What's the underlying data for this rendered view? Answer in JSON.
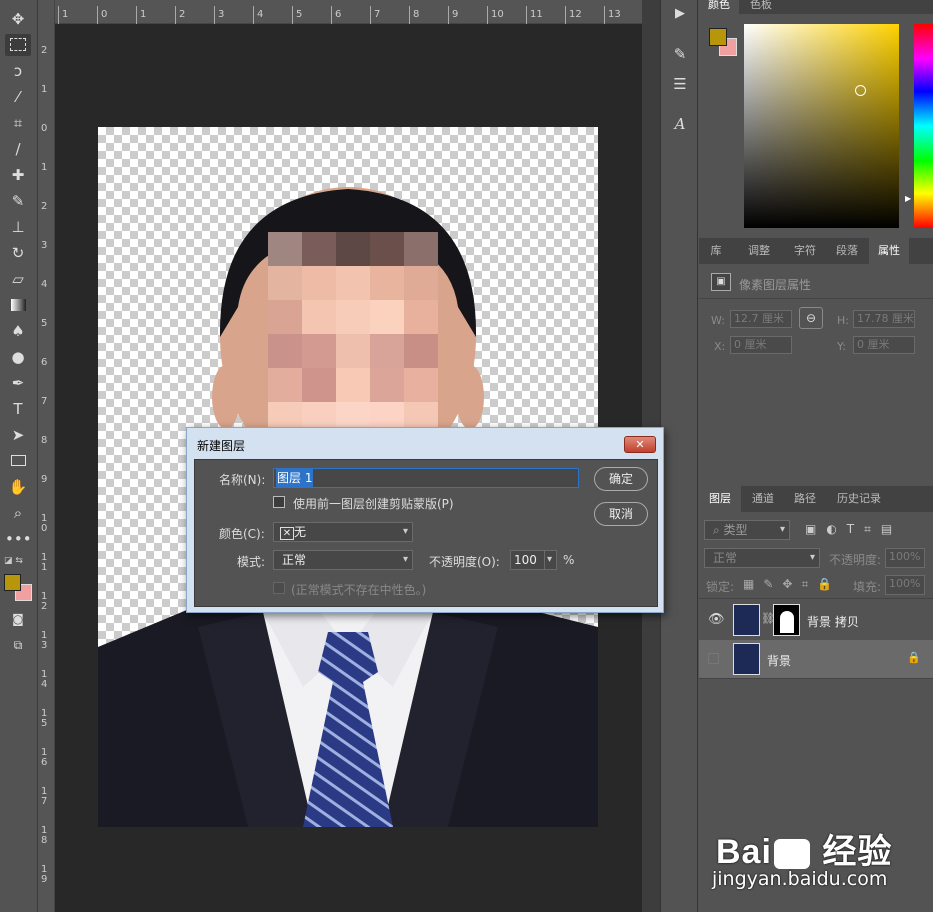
{
  "rulers": {
    "h_ticks": [
      "1",
      "0",
      "1",
      "2",
      "3",
      "4",
      "5",
      "6",
      "7",
      "8",
      "9",
      "10",
      "11",
      "12",
      "13"
    ],
    "v_ticks": [
      "2",
      "1",
      "0",
      "1",
      "2",
      "3",
      "4",
      "5",
      "6",
      "7",
      "8",
      "9",
      "1\n0",
      "1\n1",
      "1\n2",
      "1\n3",
      "1\n4",
      "1\n5",
      "1\n6",
      "1\n7",
      "1\n8",
      "1\n9"
    ]
  },
  "colors": {
    "foreground": "#b8960c",
    "background": "#f0a0a0",
    "accent": "#2d73c8"
  },
  "color_panel": {
    "tabs": [
      "颜色",
      "色板"
    ]
  },
  "properties_panel": {
    "tabs": [
      "库",
      "调整",
      "字符",
      "段落",
      "属性"
    ],
    "title": "像素图层属性",
    "w_label": "W:",
    "w_value": "12.7 厘米",
    "h_label": "H:",
    "h_value": "17.78 厘米",
    "x_label": "X:",
    "x_value": "0 厘米",
    "y_label": "Y:",
    "y_value": "0 厘米"
  },
  "layers_panel": {
    "tabs": [
      "图层",
      "通道",
      "路径",
      "历史记录"
    ],
    "filter_label": "类型",
    "blend_mode": "正常",
    "opacity_label": "不透明度:",
    "opacity_value": "100%",
    "lock_label": "锁定:",
    "fill_label": "填充:",
    "fill_value": "100%",
    "layers": [
      {
        "name": "背景 拷贝",
        "visible": true,
        "has_mask": true
      },
      {
        "name": "背景",
        "visible": false,
        "locked": true
      }
    ]
  },
  "dialog": {
    "title": "新建图层",
    "close": "✕",
    "name_label": "名称(N):",
    "name_value": "图层 1",
    "clip_label": "使用前一图层创建剪贴蒙版(P)",
    "color_label": "颜色(C):",
    "color_value": "无",
    "mode_label": "模式:",
    "mode_value": "正常",
    "opacity_label": "不透明度(O):",
    "opacity_value": "100",
    "percent": "%",
    "neutral_label": "(正常模式不存在中性色。)",
    "ok": "确定",
    "cancel": "取消"
  },
  "watermark": {
    "logo": "Bai du 经验",
    "url": "jingyan.baidu.com"
  }
}
